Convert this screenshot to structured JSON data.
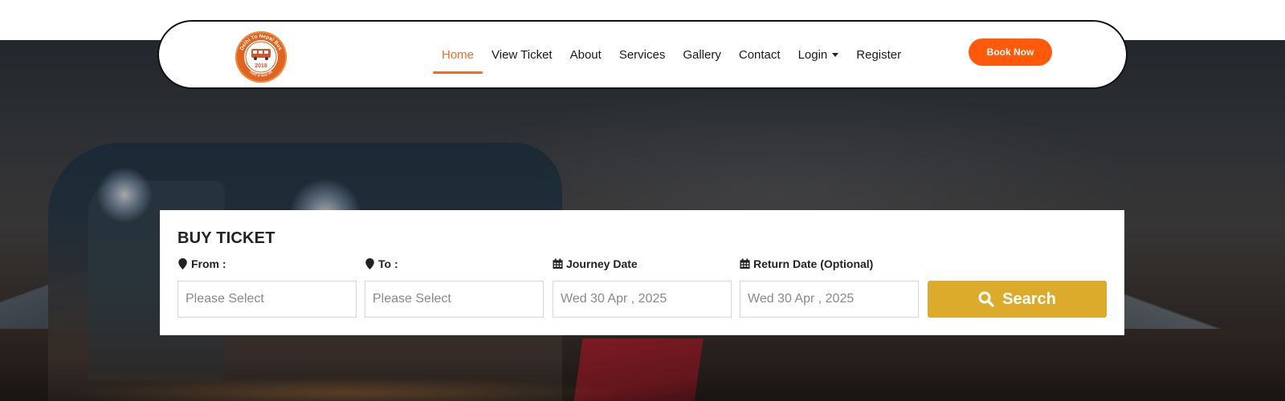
{
  "brand": {
    "logo_text": "Delhi To Nepal Bus",
    "logo_year": "2018",
    "logo_subtext": "दिल्ली से नेपाल बस"
  },
  "nav": {
    "items": [
      {
        "label": "Home",
        "active": true
      },
      {
        "label": "View Ticket",
        "active": false
      },
      {
        "label": "About",
        "active": false
      },
      {
        "label": "Services",
        "active": false
      },
      {
        "label": "Gallery",
        "active": false
      },
      {
        "label": "Contact",
        "active": false
      },
      {
        "label": "Login",
        "active": false,
        "dropdown": true
      },
      {
        "label": "Register",
        "active": false
      }
    ],
    "book_now_label": "Book Now"
  },
  "ticket_form": {
    "title": "BUY TICKET",
    "from": {
      "label": "From :",
      "placeholder": "Please Select",
      "icon": "map-marker-icon"
    },
    "to": {
      "label": "To :",
      "placeholder": "Please Select",
      "icon": "map-marker-icon"
    },
    "journey_date": {
      "label": "Journey Date",
      "value": "Wed 30 Apr , 2025",
      "icon": "calendar-icon"
    },
    "return_date": {
      "label": "Return Date (Optional)",
      "value": "Wed 30 Apr , 2025",
      "icon": "calendar-icon"
    },
    "search_label": "Search"
  },
  "colors": {
    "accent": "#f26b2b",
    "book_button": "#ff5a0a",
    "search_button": "#dcab2b",
    "logo": "#e0631f"
  }
}
